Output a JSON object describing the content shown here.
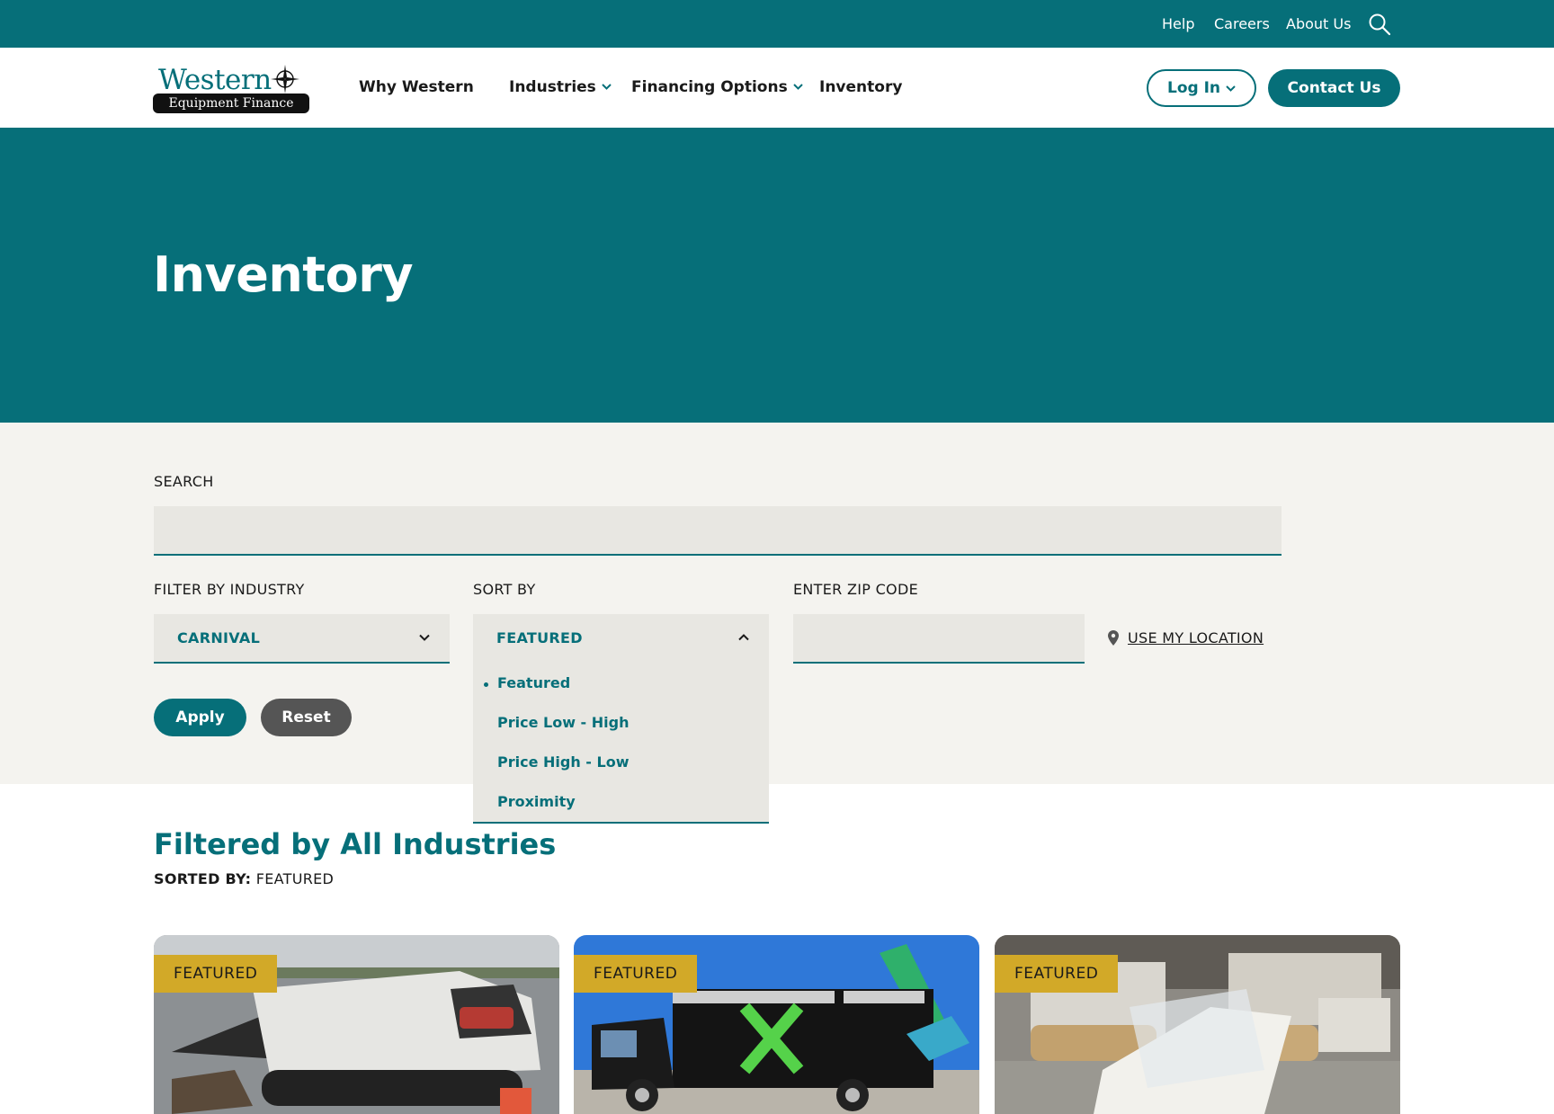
{
  "utility_nav": {
    "links": [
      "Help",
      "Careers",
      "About Us"
    ]
  },
  "brand": {
    "name_top": "Western",
    "name_bottom": "Equipment Finance"
  },
  "main_nav": {
    "why": "Why Western",
    "industries": "Industries",
    "financing": "Financing Options",
    "inventory": "Inventory",
    "login": "Log In",
    "contact": "Contact Us"
  },
  "hero": {
    "title": "Inventory"
  },
  "filters": {
    "search_label": "SEARCH",
    "search_value": "",
    "industry_label": "FILTER BY INDUSTRY",
    "industry_value": "CARNIVAL",
    "sort_label": "SORT BY",
    "sort_value": "FEATURED",
    "sort_options": [
      "Featured",
      "Price Low - High",
      "Price High - Low",
      "Proximity"
    ],
    "zip_label": "ENTER ZIP CODE",
    "zip_value": "",
    "use_location": "USE MY LOCATION",
    "apply": "Apply",
    "reset": "Reset"
  },
  "results": {
    "heading": "Filtered by All Industries",
    "sorted_prefix": "SORTED BY:",
    "sorted_value": "FEATURED",
    "cards": [
      {
        "badge": "FEATURED",
        "image": "compact track loader"
      },
      {
        "badge": "FEATURED",
        "image": "trash bin cleaning truck"
      },
      {
        "badge": "FEATURED",
        "image": "golf carts"
      }
    ]
  },
  "colors": {
    "brand_teal": "#066f79",
    "badge_gold": "#d2a928",
    "section_bg": "#f4f3ef",
    "field_bg": "#e8e7e2"
  }
}
